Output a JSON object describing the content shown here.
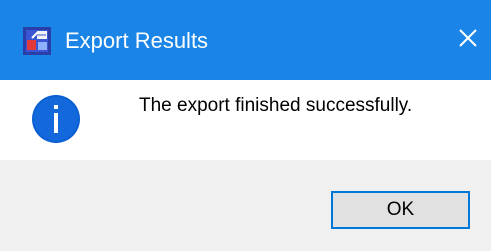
{
  "window": {
    "title": "Export Results",
    "app_icon": "export-app-icon",
    "close_icon": "close-icon",
    "titlebar_color": "#1a85e6"
  },
  "body": {
    "icon": "info-icon",
    "icon_color": "#0c5fd0",
    "message": "The export finished successfully."
  },
  "footer": {
    "ok_label": "OK",
    "button_border_color": "#0078d7"
  }
}
